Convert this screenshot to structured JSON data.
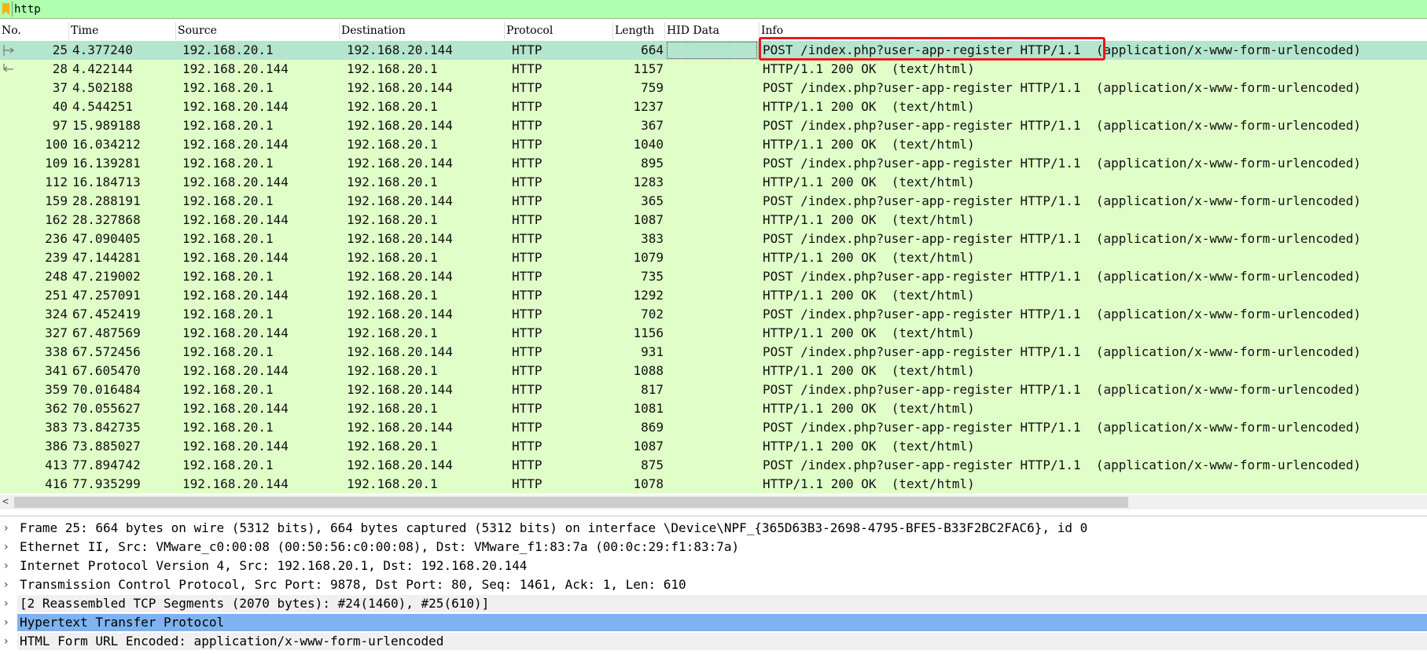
{
  "filter": {
    "value": "http",
    "icon": "bookmark-icon"
  },
  "columns": {
    "no": "No.",
    "time": "Time",
    "source": "Source",
    "destination": "Destination",
    "protocol": "Protocol",
    "length": "Length",
    "hid": "HID Data",
    "info": "Info"
  },
  "packets": [
    {
      "no": "25",
      "time": "4.377240",
      "src": "192.168.20.1",
      "dst": "192.168.20.144",
      "proto": "HTTP",
      "len": "664",
      "info": "POST /index.php?user-app-register HTTP/1.1  (application/x-www-form-urlencoded)"
    },
    {
      "no": "28",
      "time": "4.422144",
      "src": "192.168.20.144",
      "dst": "192.168.20.1",
      "proto": "HTTP",
      "len": "1157",
      "info": "HTTP/1.1 200 OK  (text/html)"
    },
    {
      "no": "37",
      "time": "4.502188",
      "src": "192.168.20.1",
      "dst": "192.168.20.144",
      "proto": "HTTP",
      "len": "759",
      "info": "POST /index.php?user-app-register HTTP/1.1  (application/x-www-form-urlencoded)"
    },
    {
      "no": "40",
      "time": "4.544251",
      "src": "192.168.20.144",
      "dst": "192.168.20.1",
      "proto": "HTTP",
      "len": "1237",
      "info": "HTTP/1.1 200 OK  (text/html)"
    },
    {
      "no": "97",
      "time": "15.989188",
      "src": "192.168.20.1",
      "dst": "192.168.20.144",
      "proto": "HTTP",
      "len": "367",
      "info": "POST /index.php?user-app-register HTTP/1.1  (application/x-www-form-urlencoded)"
    },
    {
      "no": "100",
      "time": "16.034212",
      "src": "192.168.20.144",
      "dst": "192.168.20.1",
      "proto": "HTTP",
      "len": "1040",
      "info": "HTTP/1.1 200 OK  (text/html)"
    },
    {
      "no": "109",
      "time": "16.139281",
      "src": "192.168.20.1",
      "dst": "192.168.20.144",
      "proto": "HTTP",
      "len": "895",
      "info": "POST /index.php?user-app-register HTTP/1.1  (application/x-www-form-urlencoded)"
    },
    {
      "no": "112",
      "time": "16.184713",
      "src": "192.168.20.144",
      "dst": "192.168.20.1",
      "proto": "HTTP",
      "len": "1283",
      "info": "HTTP/1.1 200 OK  (text/html)"
    },
    {
      "no": "159",
      "time": "28.288191",
      "src": "192.168.20.1",
      "dst": "192.168.20.144",
      "proto": "HTTP",
      "len": "365",
      "info": "POST /index.php?user-app-register HTTP/1.1  (application/x-www-form-urlencoded)"
    },
    {
      "no": "162",
      "time": "28.327868",
      "src": "192.168.20.144",
      "dst": "192.168.20.1",
      "proto": "HTTP",
      "len": "1087",
      "info": "HTTP/1.1 200 OK  (text/html)"
    },
    {
      "no": "236",
      "time": "47.090405",
      "src": "192.168.20.1",
      "dst": "192.168.20.144",
      "proto": "HTTP",
      "len": "383",
      "info": "POST /index.php?user-app-register HTTP/1.1  (application/x-www-form-urlencoded)"
    },
    {
      "no": "239",
      "time": "47.144281",
      "src": "192.168.20.144",
      "dst": "192.168.20.1",
      "proto": "HTTP",
      "len": "1079",
      "info": "HTTP/1.1 200 OK  (text/html)"
    },
    {
      "no": "248",
      "time": "47.219002",
      "src": "192.168.20.1",
      "dst": "192.168.20.144",
      "proto": "HTTP",
      "len": "735",
      "info": "POST /index.php?user-app-register HTTP/1.1  (application/x-www-form-urlencoded)"
    },
    {
      "no": "251",
      "time": "47.257091",
      "src": "192.168.20.144",
      "dst": "192.168.20.1",
      "proto": "HTTP",
      "len": "1292",
      "info": "HTTP/1.1 200 OK  (text/html)"
    },
    {
      "no": "324",
      "time": "67.452419",
      "src": "192.168.20.1",
      "dst": "192.168.20.144",
      "proto": "HTTP",
      "len": "702",
      "info": "POST /index.php?user-app-register HTTP/1.1  (application/x-www-form-urlencoded)"
    },
    {
      "no": "327",
      "time": "67.487569",
      "src": "192.168.20.144",
      "dst": "192.168.20.1",
      "proto": "HTTP",
      "len": "1156",
      "info": "HTTP/1.1 200 OK  (text/html)"
    },
    {
      "no": "338",
      "time": "67.572456",
      "src": "192.168.20.1",
      "dst": "192.168.20.144",
      "proto": "HTTP",
      "len": "931",
      "info": "POST /index.php?user-app-register HTTP/1.1  (application/x-www-form-urlencoded)"
    },
    {
      "no": "341",
      "time": "67.605470",
      "src": "192.168.20.144",
      "dst": "192.168.20.1",
      "proto": "HTTP",
      "len": "1088",
      "info": "HTTP/1.1 200 OK  (text/html)"
    },
    {
      "no": "359",
      "time": "70.016484",
      "src": "192.168.20.1",
      "dst": "192.168.20.144",
      "proto": "HTTP",
      "len": "817",
      "info": "POST /index.php?user-app-register HTTP/1.1  (application/x-www-form-urlencoded)"
    },
    {
      "no": "362",
      "time": "70.055627",
      "src": "192.168.20.144",
      "dst": "192.168.20.1",
      "proto": "HTTP",
      "len": "1081",
      "info": "HTTP/1.1 200 OK  (text/html)"
    },
    {
      "no": "383",
      "time": "73.842735",
      "src": "192.168.20.1",
      "dst": "192.168.20.144",
      "proto": "HTTP",
      "len": "869",
      "info": "POST /index.php?user-app-register HTTP/1.1  (application/x-www-form-urlencoded)"
    },
    {
      "no": "386",
      "time": "73.885027",
      "src": "192.168.20.144",
      "dst": "192.168.20.1",
      "proto": "HTTP",
      "len": "1087",
      "info": "HTTP/1.1 200 OK  (text/html)"
    },
    {
      "no": "413",
      "time": "77.894742",
      "src": "192.168.20.1",
      "dst": "192.168.20.144",
      "proto": "HTTP",
      "len": "875",
      "info": "POST /index.php?user-app-register HTTP/1.1  (application/x-www-form-urlencoded)"
    },
    {
      "no": "416",
      "time": "77.935299",
      "src": "192.168.20.144",
      "dst": "192.168.20.1",
      "proto": "HTTP",
      "len": "1078",
      "info": "HTTP/1.1 200 OK  (text/html)"
    }
  ],
  "selected_packet_index": 0,
  "details": [
    {
      "text": "Frame 25: 664 bytes on wire (5312 bits), 664 bytes captured (5312 bits) on interface \\Device\\NPF_{365D63B3-2698-4795-BFE5-B33F2BC2FAC6}, id 0",
      "expandable": true
    },
    {
      "text": "Ethernet II, Src: VMware_c0:00:08 (00:50:56:c0:00:08), Dst: VMware_f1:83:7a (00:0c:29:f1:83:7a)",
      "expandable": true
    },
    {
      "text": "Internet Protocol Version 4, Src: 192.168.20.1, Dst: 192.168.20.144",
      "expandable": true
    },
    {
      "text": "Transmission Control Protocol, Src Port: 9878, Dst Port: 80, Seq: 1461, Ack: 1, Len: 610",
      "expandable": true
    },
    {
      "text": "[2 Reassembled TCP Segments (2070 bytes): #24(1460), #25(610)]",
      "expandable": true,
      "grey": true
    },
    {
      "text": "Hypertext Transfer Protocol",
      "expandable": true,
      "selected": true
    },
    {
      "text": "HTML Form URL Encoded: application/x-www-form-urlencoded",
      "expandable": true,
      "grey": true
    }
  ],
  "colors": {
    "filter_bg": "#afffaf",
    "row_bg": "#e0ffc8",
    "selected_row_bg": "#b4e5ce",
    "detail_selected_bg": "#7fb2f0",
    "highlight_border": "#e8191b"
  }
}
